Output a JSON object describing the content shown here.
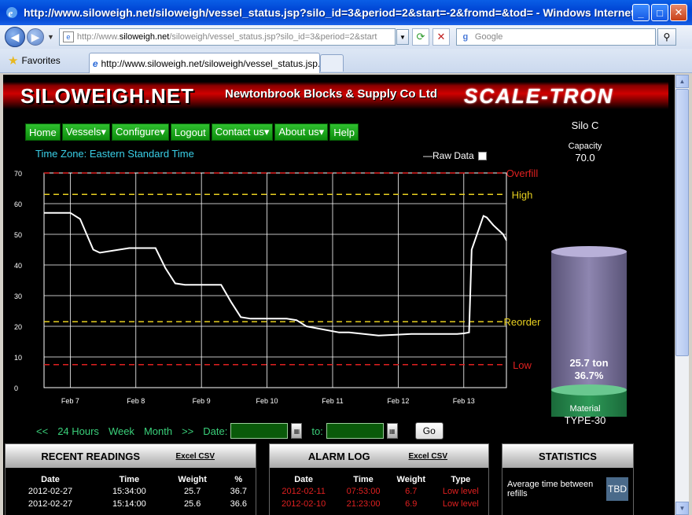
{
  "window": {
    "title": "http://www.siloweigh.net/siloweigh/vessel_status.jsp?silo_id=3&period=2&start=-2&fromd=&tod= - Windows Internet Expl"
  },
  "browser": {
    "url_prefix": "http://www.",
    "url_host": "siloweigh.net",
    "url_rest": "/siloweigh/vessel_status.jsp?silo_id=3&period=2&start",
    "search_placeholder": "Google",
    "favorites_label": "Favorites",
    "tab_title": "http://www.siloweigh.net/siloweigh/vessel_status.jsp..."
  },
  "banner": {
    "logo": "SILOWEIGH.NET",
    "company": "Newtonbrook Blocks & Supply Co Ltd",
    "brand": "SCALE-TRON"
  },
  "menu": [
    {
      "label": "Home"
    },
    {
      "label": "Vessels▾"
    },
    {
      "label": "Configure▾"
    },
    {
      "label": "Logout"
    },
    {
      "label": "Contact us▾"
    },
    {
      "label": "About us▾"
    },
    {
      "label": "Help"
    }
  ],
  "timezone": "Time Zone: Eastern Standard Time",
  "raw_data_label": "—Raw Data",
  "silo": {
    "name": "Silo C",
    "capacity_label": "Capacity",
    "capacity": "70.0",
    "weight_text": "25.7 ton",
    "percent_text": "36.7%",
    "fill_fraction": 0.367,
    "material_label": "Material",
    "material": "TYPE-30"
  },
  "colors": {
    "overfill": "#e02020",
    "high": "#e8d020",
    "reorder": "#e8d020",
    "low": "#e02020",
    "nav_green": "#3ad07a",
    "silo_top": "#8e86b0",
    "silo_material": "#2e9a58"
  },
  "chart_data": {
    "type": "line",
    "ylim": [
      0,
      70
    ],
    "yticks": [
      "0",
      "10",
      "20",
      "30",
      "40",
      "50",
      "60",
      "70"
    ],
    "xticks": [
      "Feb 7",
      "Feb 8",
      "Feb 9",
      "Feb 10",
      "Feb 11",
      "Feb 12",
      "Feb 13"
    ],
    "thresholds": [
      {
        "name": "Overfill",
        "value": 70,
        "color": "#e02020"
      },
      {
        "name": "High",
        "value": 63,
        "color": "#e8d020"
      },
      {
        "name": "Reorder",
        "value": 21.5,
        "color": "#e8d020"
      },
      {
        "name": "Low",
        "value": 7.5,
        "color": "#e02020"
      }
    ],
    "series": [
      {
        "x": [
          6.6,
          7.0,
          7.15,
          7.25,
          7.35,
          7.45,
          7.9,
          8.3,
          8.45,
          8.6,
          8.75,
          9.3,
          9.45,
          9.6,
          9.75,
          10.3,
          10.45,
          10.6,
          11.1,
          11.25,
          11.7,
          12.2,
          12.5,
          12.9,
          13.0,
          13.08,
          13.12,
          13.3,
          13.35,
          13.45,
          13.6,
          13.65
        ],
        "y": [
          57,
          57,
          55,
          50,
          45,
          44,
          45.5,
          45.5,
          39,
          34,
          33.5,
          33.5,
          28,
          23,
          22.5,
          22.5,
          22,
          20,
          18,
          18,
          17,
          17.5,
          17.5,
          17.5,
          17.7,
          18,
          45,
          56,
          55.5,
          53,
          50,
          48
        ]
      }
    ]
  },
  "range_links": {
    "prev": "<<",
    "h24": "24 Hours",
    "week": "Week",
    "month": "Month",
    "next": ">>",
    "date_label": "Date:",
    "to_label": "to:",
    "go": "Go"
  },
  "recent": {
    "title": "RECENT READINGS",
    "excel": "Excel CSV",
    "headers": [
      "Date",
      "Time",
      "Weight",
      "%"
    ],
    "rows": [
      [
        "2012-02-27",
        "15:34:00",
        "25.7",
        "36.7"
      ],
      [
        "2012-02-27",
        "15:14:00",
        "25.6",
        "36.6"
      ]
    ]
  },
  "alarm": {
    "title": "ALARM LOG",
    "excel": "Excel CSV",
    "headers": [
      "Date",
      "Time",
      "Weight",
      "Type"
    ],
    "rows": [
      [
        "2012-02-11",
        "07:53:00",
        "6.7",
        "Low level"
      ],
      [
        "2012-02-10",
        "21:23:00",
        "6.9",
        "Low level"
      ]
    ]
  },
  "stats": {
    "title": "STATISTICS",
    "avg_label": "Average time between refills",
    "avg_value": "TBD"
  }
}
